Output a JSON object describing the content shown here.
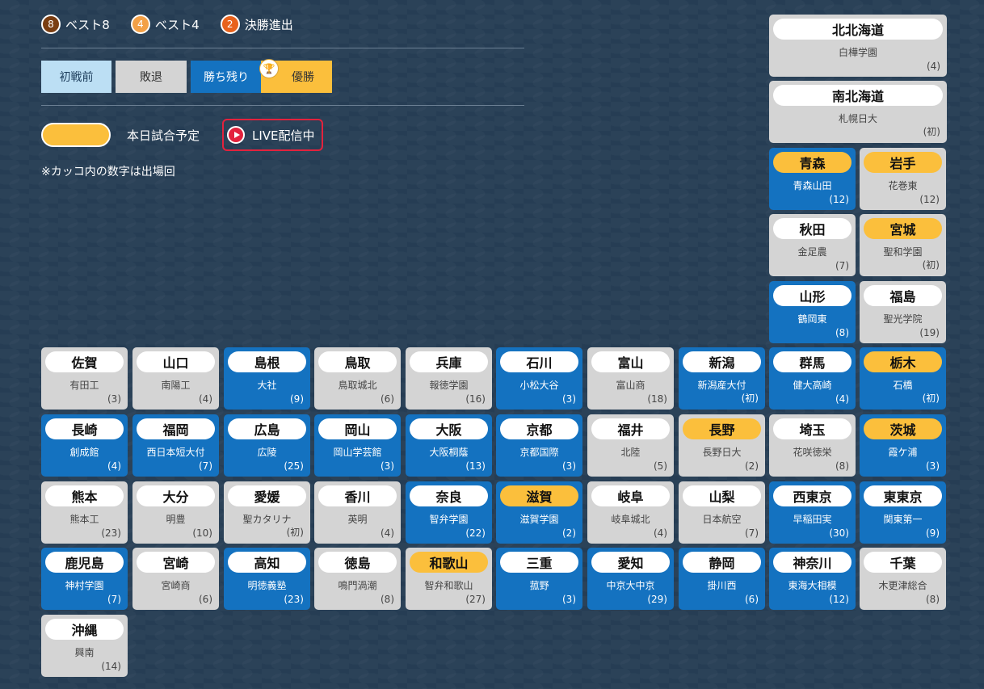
{
  "legend": {
    "badges": [
      {
        "num": "8",
        "label": "ベスト8",
        "color": "#7a3e12"
      },
      {
        "num": "4",
        "label": "ベスト4",
        "color": "#f3a046"
      },
      {
        "num": "2",
        "label": "決勝進出",
        "color": "#e8621c"
      }
    ],
    "status": {
      "before": "初戦前",
      "lost": "敗退",
      "alive": "勝ち残り",
      "champion": "優勝"
    },
    "today_label": "本日試合予定",
    "live_label": "LIVE配信中",
    "note": "※カッコ内の数字は出場回"
  },
  "colors": {
    "alive": "#1472c0",
    "lost": "#d4d4d4",
    "today": "#fbbf3c",
    "live": "#e3223d"
  },
  "cards": [
    {
      "pref": "北北海道",
      "school": "白樺学園",
      "app": "(4)",
      "alive": false,
      "today": false
    },
    {
      "pref": "南北海道",
      "school": "札幌日大",
      "app": "(初)",
      "alive": false,
      "today": false
    },
    {
      "pref": "青森",
      "school": "青森山田",
      "app": "(12)",
      "alive": true,
      "today": true
    },
    {
      "pref": "岩手",
      "school": "花巻東",
      "app": "(12)",
      "alive": false,
      "today": true
    },
    {
      "pref": "秋田",
      "school": "金足農",
      "app": "(7)",
      "alive": false,
      "today": false
    },
    {
      "pref": "宮城",
      "school": "聖和学園",
      "app": "(初)",
      "alive": false,
      "today": true
    },
    {
      "pref": "山形",
      "school": "鶴岡東",
      "app": "(8)",
      "alive": true,
      "today": false
    },
    {
      "pref": "福島",
      "school": "聖光学院",
      "app": "(19)",
      "alive": false,
      "today": false
    },
    {
      "pref": "佐賀",
      "school": "有田工",
      "app": "(3)",
      "alive": false,
      "today": false
    },
    {
      "pref": "山口",
      "school": "南陽工",
      "app": "(4)",
      "alive": false,
      "today": false
    },
    {
      "pref": "島根",
      "school": "大社",
      "app": "(9)",
      "alive": true,
      "today": false
    },
    {
      "pref": "鳥取",
      "school": "鳥取城北",
      "app": "(6)",
      "alive": false,
      "today": false
    },
    {
      "pref": "兵庫",
      "school": "報徳学園",
      "app": "(16)",
      "alive": false,
      "today": false
    },
    {
      "pref": "石川",
      "school": "小松大谷",
      "app": "(3)",
      "alive": true,
      "today": false
    },
    {
      "pref": "富山",
      "school": "富山商",
      "app": "(18)",
      "alive": false,
      "today": false
    },
    {
      "pref": "新潟",
      "school": "新潟産大付",
      "app": "(初)",
      "alive": true,
      "today": false
    },
    {
      "pref": "群馬",
      "school": "健大高崎",
      "app": "(4)",
      "alive": true,
      "today": false
    },
    {
      "pref": "栃木",
      "school": "石橋",
      "app": "(初)",
      "alive": true,
      "today": true
    },
    {
      "pref": "長崎",
      "school": "創成館",
      "app": "(4)",
      "alive": true,
      "today": false
    },
    {
      "pref": "福岡",
      "school": "西日本短大付",
      "app": "(7)",
      "alive": true,
      "today": false
    },
    {
      "pref": "広島",
      "school": "広陵",
      "app": "(25)",
      "alive": true,
      "today": false
    },
    {
      "pref": "岡山",
      "school": "岡山学芸館",
      "app": "(3)",
      "alive": true,
      "today": false
    },
    {
      "pref": "大阪",
      "school": "大阪桐蔭",
      "app": "(13)",
      "alive": true,
      "today": false
    },
    {
      "pref": "京都",
      "school": "京都国際",
      "app": "(3)",
      "alive": true,
      "today": false
    },
    {
      "pref": "福井",
      "school": "北陸",
      "app": "(5)",
      "alive": false,
      "today": false
    },
    {
      "pref": "長野",
      "school": "長野日大",
      "app": "(2)",
      "alive": false,
      "today": true
    },
    {
      "pref": "埼玉",
      "school": "花咲徳栄",
      "app": "(8)",
      "alive": false,
      "today": false
    },
    {
      "pref": "茨城",
      "school": "霞ケ浦",
      "app": "(3)",
      "alive": true,
      "today": true
    },
    {
      "pref": "熊本",
      "school": "熊本工",
      "app": "(23)",
      "alive": false,
      "today": false
    },
    {
      "pref": "大分",
      "school": "明豊",
      "app": "(10)",
      "alive": false,
      "today": false
    },
    {
      "pref": "愛媛",
      "school": "聖カタリナ",
      "app": "(初)",
      "alive": false,
      "today": false
    },
    {
      "pref": "香川",
      "school": "英明",
      "app": "(4)",
      "alive": false,
      "today": false
    },
    {
      "pref": "奈良",
      "school": "智弁学園",
      "app": "(22)",
      "alive": true,
      "today": false
    },
    {
      "pref": "滋賀",
      "school": "滋賀学園",
      "app": "(2)",
      "alive": true,
      "today": true
    },
    {
      "pref": "岐阜",
      "school": "岐阜城北",
      "app": "(4)",
      "alive": false,
      "today": false
    },
    {
      "pref": "山梨",
      "school": "日本航空",
      "app": "(7)",
      "alive": false,
      "today": false
    },
    {
      "pref": "西東京",
      "school": "早稲田実",
      "app": "(30)",
      "alive": true,
      "today": false
    },
    {
      "pref": "東東京",
      "school": "関東第一",
      "app": "(9)",
      "alive": true,
      "today": false
    },
    {
      "pref": "鹿児島",
      "school": "神村学園",
      "app": "(7)",
      "alive": true,
      "today": false
    },
    {
      "pref": "宮崎",
      "school": "宮崎商",
      "app": "(6)",
      "alive": false,
      "today": false
    },
    {
      "pref": "高知",
      "school": "明徳義塾",
      "app": "(23)",
      "alive": true,
      "today": false
    },
    {
      "pref": "徳島",
      "school": "鳴門渦潮",
      "app": "(8)",
      "alive": false,
      "today": false
    },
    {
      "pref": "和歌山",
      "school": "智弁和歌山",
      "app": "(27)",
      "alive": false,
      "today": true
    },
    {
      "pref": "三重",
      "school": "菰野",
      "app": "(3)",
      "alive": true,
      "today": false
    },
    {
      "pref": "愛知",
      "school": "中京大中京",
      "app": "(29)",
      "alive": true,
      "today": false
    },
    {
      "pref": "静岡",
      "school": "掛川西",
      "app": "(6)",
      "alive": true,
      "today": false
    },
    {
      "pref": "神奈川",
      "school": "東海大相模",
      "app": "(12)",
      "alive": true,
      "today": false
    },
    {
      "pref": "千葉",
      "school": "木更津総合",
      "app": "(8)",
      "alive": false,
      "today": false
    },
    {
      "pref": "沖縄",
      "school": "興南",
      "app": "(14)",
      "alive": false,
      "today": false
    }
  ]
}
